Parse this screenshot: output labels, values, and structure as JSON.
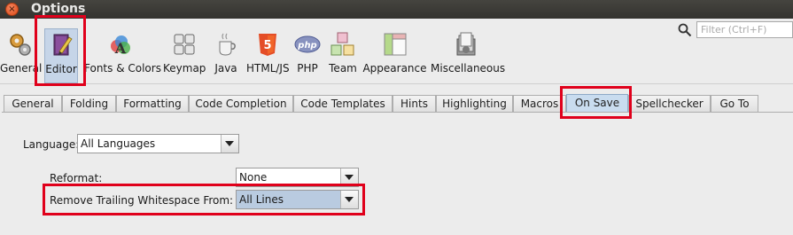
{
  "window": {
    "title": "Options",
    "close_symbol": "×"
  },
  "toolbar": {
    "categories": [
      {
        "label": "General",
        "icon": "gear-icon"
      },
      {
        "label": "Editor",
        "icon": "editor-book-icon",
        "selected": true
      },
      {
        "label": "Fonts & Colors",
        "icon": "fonts-colors-icon"
      },
      {
        "label": "Keymap",
        "icon": "keyboard-icon"
      },
      {
        "label": "Java",
        "icon": "java-cup-icon"
      },
      {
        "label": "HTML/JS",
        "icon": "html5-icon"
      },
      {
        "label": "PHP",
        "icon": "php-icon"
      },
      {
        "label": "Team",
        "icon": "team-cubes-icon"
      },
      {
        "label": "Appearance",
        "icon": "appearance-icon"
      },
      {
        "label": "Miscellaneous",
        "icon": "miscellaneous-icon"
      }
    ],
    "search_placeholder": "Filter (Ctrl+F)"
  },
  "tabs": [
    "General",
    "Folding",
    "Formatting",
    "Code Completion",
    "Code Templates",
    "Hints",
    "Highlighting",
    "Macros",
    "On Save",
    "Spellchecker",
    "Go To"
  ],
  "active_tab": "On Save",
  "form": {
    "language_label": "Language:",
    "language_value": "All Languages",
    "reformat_label": "Reformat:",
    "reformat_value": "None",
    "trailing_label": "Remove Trailing Whitespace From:",
    "trailing_value": "All Lines"
  },
  "colors": {
    "highlight": "#e0001b",
    "selected_bg": "#c6d5e8",
    "title_bar": "#3c3b37"
  }
}
